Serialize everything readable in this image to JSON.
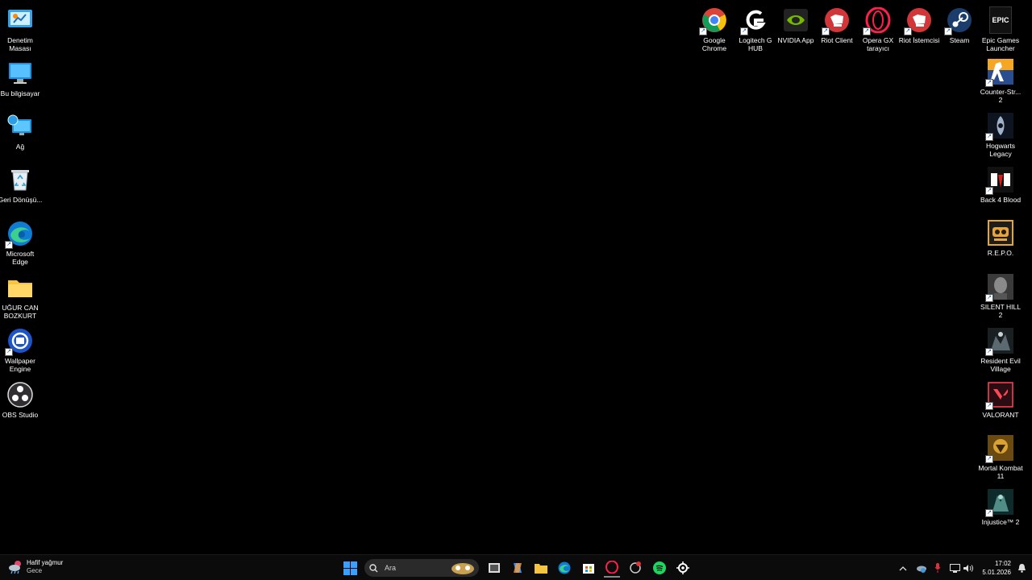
{
  "desktop": {
    "left_icons": [
      {
        "label": "Denetim Masası",
        "icon": "control-panel-icon"
      },
      {
        "label": "Bu bilgisayar",
        "icon": "this-pc-icon"
      },
      {
        "label": "Ağ",
        "icon": "network-icon"
      },
      {
        "label": "Geri Dönüşü...",
        "icon": "recycle-bin-icon"
      },
      {
        "label": "Microsoft Edge",
        "icon": "edge-icon"
      },
      {
        "label": "UĞUR CAN BOZKURT",
        "icon": "folder-icon"
      },
      {
        "label": "Wallpaper Engine",
        "icon": "wallpaper-engine-icon"
      },
      {
        "label": "OBS Studio",
        "icon": "obs-icon"
      }
    ],
    "top_icons": [
      {
        "label": "Google Chrome",
        "icon": "chrome-icon"
      },
      {
        "label": "Logitech G HUB",
        "icon": "logitech-g-icon"
      },
      {
        "label": "NVIDIA App",
        "icon": "nvidia-icon"
      },
      {
        "label": "Riot Client",
        "icon": "riot-client-icon"
      },
      {
        "label": "Opera GX tarayıcı",
        "icon": "opera-gx-icon"
      },
      {
        "label": "Riot İstemcisi",
        "icon": "riot-istemcisi-icon"
      },
      {
        "label": "Steam",
        "icon": "steam-icon"
      },
      {
        "label": "Epic Games Launcher",
        "icon": "epic-games-icon",
        "logo_text": "EPIC"
      }
    ],
    "right_icons": [
      {
        "label": "Counter-Str... 2",
        "icon": "counter-strike-icon"
      },
      {
        "label": "Hogwarts Legacy",
        "icon": "hogwarts-legacy-icon"
      },
      {
        "label": "Back 4 Blood",
        "icon": "back-4-blood-icon"
      },
      {
        "label": "R.E.P.O.",
        "icon": "repo-icon"
      },
      {
        "label": "SILENT HILL 2",
        "icon": "silent-hill-icon"
      },
      {
        "label": "Resident Evil Village",
        "icon": "resident-evil-icon"
      },
      {
        "label": "VALORANT",
        "icon": "valorant-icon"
      },
      {
        "label": "Mortal Kombat 11",
        "icon": "mortal-kombat-icon"
      },
      {
        "label": "Injustice™ 2",
        "icon": "injustice-icon"
      }
    ]
  },
  "taskbar": {
    "weather": {
      "title": "Hafif yağmur",
      "subtitle": "Gece",
      "icon": "rain-night-icon"
    },
    "search_placeholder": "Ara",
    "pinned": [
      "start-icon",
      "task-view-icon",
      "copilot-icon",
      "file-explorer-icon",
      "edge-icon",
      "store-icon",
      "opera-gx-icon",
      "riot-icon",
      "spotify-icon",
      "steelseries-icon"
    ],
    "tray": [
      "chevron-up-icon",
      "onedrive-icon",
      "microphone-icon",
      "network-icon",
      "speaker-icon"
    ],
    "clock": {
      "time": "17:02",
      "date": "5.01.2026"
    },
    "notification_icon": "notification-icon"
  },
  "colors": {
    "background": "#000000",
    "taskbar": "#0b0b0b",
    "accent": "#0078d4"
  }
}
